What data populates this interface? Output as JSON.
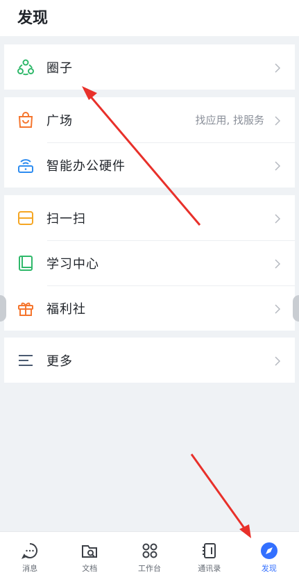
{
  "header": {
    "title": "发现"
  },
  "groups": [
    {
      "items": [
        {
          "label": "圈子",
          "sub": "",
          "icon": "circle-group-icon"
        }
      ]
    },
    {
      "items": [
        {
          "label": "广场",
          "sub": "找应用, 找服务",
          "icon": "shopping-bag-icon"
        },
        {
          "label": "智能办公硬件",
          "sub": "",
          "icon": "router-device-icon"
        }
      ]
    },
    {
      "items": [
        {
          "label": "扫一扫",
          "sub": "",
          "icon": "scan-icon"
        },
        {
          "label": "学习中心",
          "sub": "",
          "icon": "book-icon"
        },
        {
          "label": "福利社",
          "sub": "",
          "icon": "gift-icon"
        }
      ]
    },
    {
      "items": [
        {
          "label": "更多",
          "sub": "",
          "icon": "menu-lines-icon"
        }
      ]
    }
  ],
  "tabbar": {
    "items": [
      {
        "label": "消息",
        "icon": "chat-bubble-icon"
      },
      {
        "label": "文档",
        "icon": "folder-icon"
      },
      {
        "label": "工作台",
        "icon": "grid-apps-icon"
      },
      {
        "label": "通讯录",
        "icon": "contacts-book-icon"
      },
      {
        "label": "发现",
        "icon": "compass-icon",
        "active": true
      }
    ]
  },
  "colors": {
    "accent": "#3370ff",
    "annotation_arrow": "#e8302a",
    "green": "#2fb86a",
    "orange": "#f5752d",
    "blue": "#2d8cf0",
    "yellow": "#f5a623"
  }
}
